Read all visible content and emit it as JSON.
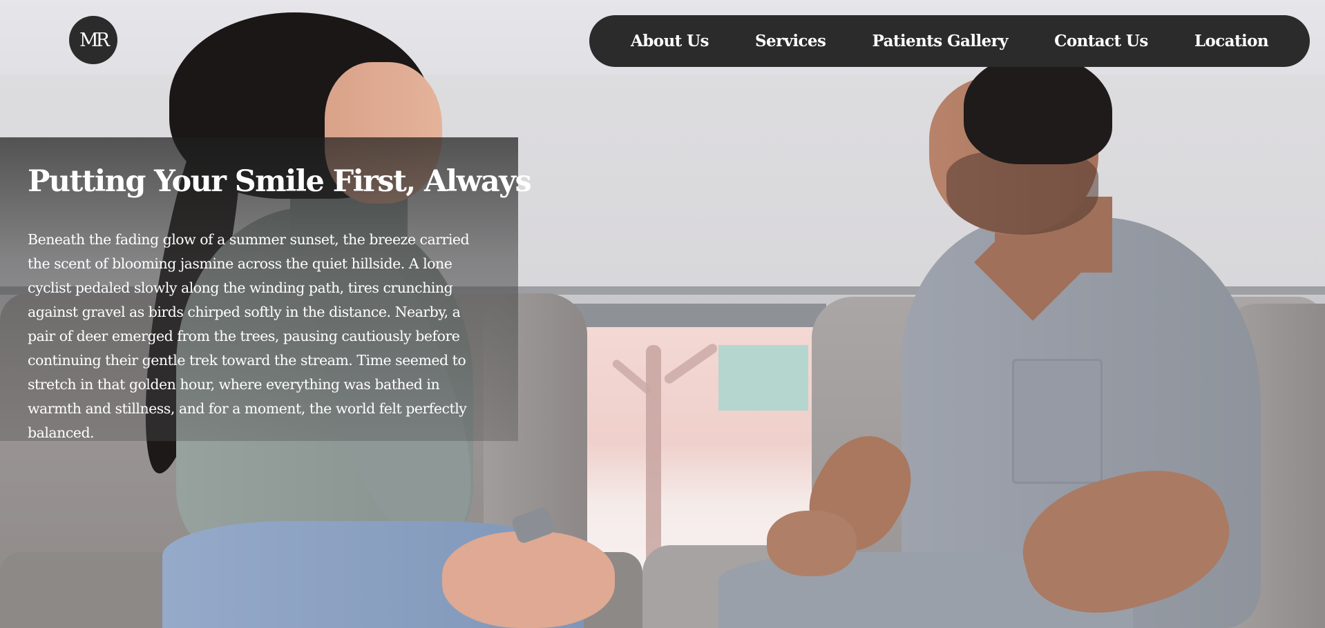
{
  "logo": {
    "text": "MR"
  },
  "nav": {
    "items": [
      {
        "label": "About Us"
      },
      {
        "label": "Services"
      },
      {
        "label": "Patients Gallery"
      },
      {
        "label": "Contact Us"
      },
      {
        "label": "Location"
      }
    ]
  },
  "hero": {
    "title": "Putting Your Smile First, Always",
    "body": "Beneath the fading glow of a summer sunset, the breeze carried the scent of blooming jasmine across the quiet hillside. A lone cyclist pedaled slowly along the winding path, tires crunching against gravel as birds chirped softly in the distance. Nearby, a pair of deer emerged from the trees, pausing cautiously before continuing their gentle trek toward the stream. Time seemed to stretch in that golden hour, where everything was bathed in warmth and stillness, and for a moment, the world felt perfectly balanced."
  },
  "colors": {
    "nav_background": "#2b2b2b",
    "logo_background": "#2b2b2b",
    "text": "#ffffff"
  }
}
